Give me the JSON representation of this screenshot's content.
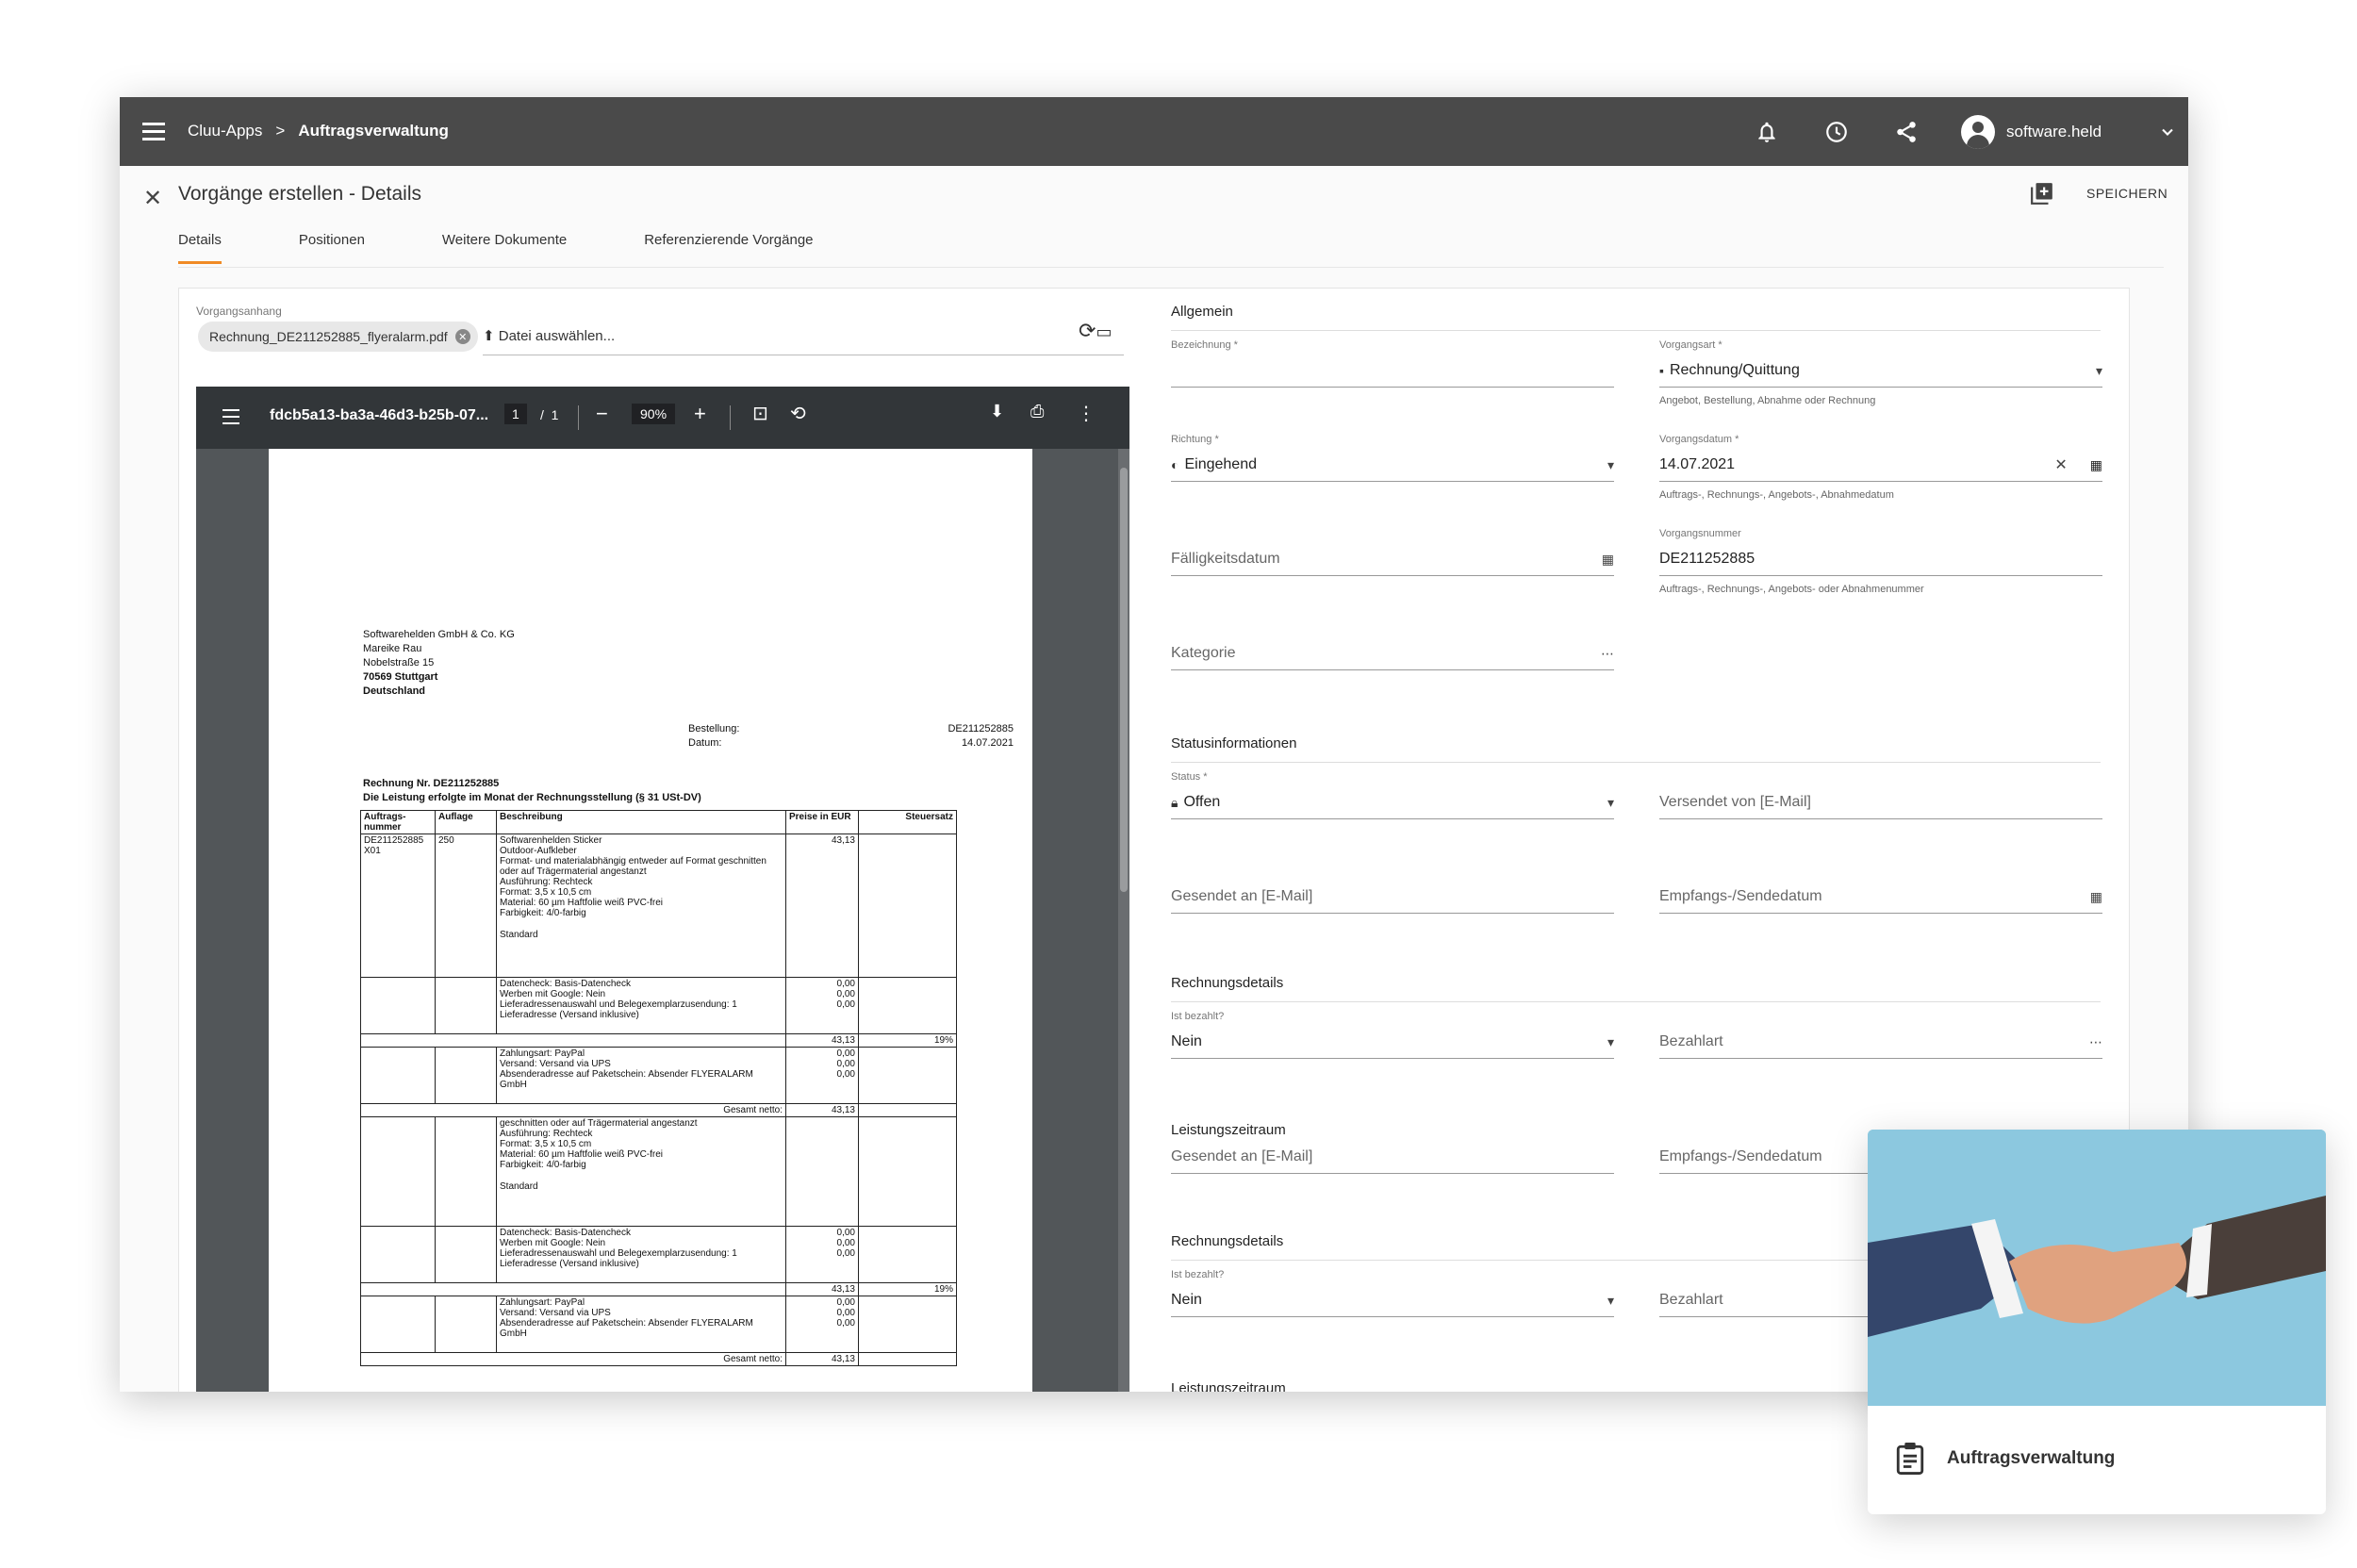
{
  "topbar": {
    "breadcrumb": [
      "Cluu-Apps",
      "Auftragsverwaltung"
    ],
    "separator": ">",
    "username": "software.held",
    "icons": [
      "menu-icon",
      "bell-icon",
      "clock-icon",
      "share-icon",
      "account-icon",
      "chevron-down-icon"
    ]
  },
  "header": {
    "title": "Vorgänge erstellen - Details",
    "save_label": "SPEICHERN",
    "tabs": [
      "Details",
      "Positionen",
      "Weitere Dokumente",
      "Referenzierende Vorgänge"
    ]
  },
  "attachment": {
    "label": "Vorgangsanhang",
    "file_chip": "Rechnung_DE211252885_flyeralarm.pdf",
    "pick_label": "Datei auswählen..."
  },
  "pdf_viewer": {
    "filename": "fdcb5a13-ba3a-46d3-b25b-07...",
    "page_current": "1",
    "page_sep": "/",
    "page_total": "1",
    "zoom": "90%",
    "document": {
      "address": [
        "Softwarehelden GmbH & Co. KG",
        "Mareike Rau",
        "Nobelstraße 15",
        "70569 Stuttgart",
        "Deutschland"
      ],
      "meta_labels": [
        "Bestellung:",
        "Datum:"
      ],
      "meta_values": [
        "DE211252885",
        "14.07.2021"
      ],
      "invoice_title": "Rechnung Nr. DE211252885",
      "invoice_note": "Die Leistung erfolgte im Monat der Rechnungsstellung (§ 31 USt-DV)",
      "columns": [
        "Auftrags-nummer",
        "Auflage",
        "Beschreibung",
        "Preise in EUR",
        "Steuersatz"
      ],
      "order_no": "DE211252885 X01",
      "quantity": "250",
      "item_lines": [
        "Softwarenhelden Sticker",
        "Outdoor-Aufkleber",
        "Format- und materialabhängig entweder auf Format geschnitten oder auf Trägermaterial angestanzt",
        "Ausführung: Rechteck",
        "Format: 3,5 x 10,5 cm",
        "Material: 60 µm Haftfolie weiß PVC-frei",
        "Farbigkeit: 4/0-farbig",
        "",
        "Standard"
      ],
      "item_price": "43,13",
      "check_lines": [
        "Datencheck: Basis-Datencheck",
        "Werben mit Google: Nein",
        "Lieferadressenauswahl und Belegexemplarzusendung: 1 Lieferadresse (Versand inklusive)"
      ],
      "check_prices": [
        "0,00",
        "0,00",
        "0,00"
      ],
      "subtotal": "43,13",
      "tax_rate": "19%",
      "pay_lines": [
        "Zahlungsart: PayPal",
        "Versand: Versand via UPS",
        "Absenderadresse auf Paketschein: Absender FLYERALARM GmbH"
      ],
      "pay_prices": [
        "0,00",
        "0,00",
        "0,00"
      ],
      "net_label": "Gesamt netto:",
      "net_value": "43,13",
      "item_lines_2": [
        "geschnitten oder auf Trägermaterial angestanzt",
        "Ausführung: Rechteck",
        "Format: 3,5 x 10,5 cm",
        "Material: 60 µm Haftfolie weiß PVC-frei",
        "Farbigkeit: 4/0-farbig",
        "",
        "Standard"
      ]
    }
  },
  "form": {
    "allgemein": {
      "title": "Allgemein",
      "bezeichnung_label": "Bezeichnung *",
      "vorgangsart_label": "Vorgangsart *",
      "vorgangsart_value": "Rechnung/Quittung",
      "vorgangsart_hint": "Angebot, Bestellung, Abnahme oder Rechnung",
      "richtung_label": "Richtung *",
      "richtung_value": "Eingehend",
      "vorgangsdatum_label": "Vorgangsdatum *",
      "vorgangsdatum_value": "14.07.2021",
      "vorgangsdatum_hint": "Auftrags-, Rechnungs-, Angebots-, Abnahmedatum",
      "faelligkeit_placeholder": "Fälligkeitsdatum",
      "vorgangsnummer_label": "Vorgangsnummer",
      "vorgangsnummer_value": "DE211252885",
      "vorgangsnummer_hint": "Auftrags-, Rechnungs-, Angebots- oder Abnahmenummer",
      "kategorie_placeholder": "Kategorie"
    },
    "status": {
      "title": "Statusinformationen",
      "status_label": "Status *",
      "status_value": "Offen",
      "versendet_placeholder": "Versendet von [E-Mail]",
      "gesendet_placeholder": "Gesendet an [E-Mail]",
      "empfangs_placeholder": "Empfangs-/Sendedatum"
    },
    "rechnung": {
      "title": "Rechnungsdetails",
      "bezahlt_label": "Ist bezahlt?",
      "bezahlt_value": "Nein",
      "bezahlart_placeholder": "Bezahlart"
    },
    "leistung": {
      "title": "Leistungszeitraum",
      "gesendet_placeholder": "Gesendet an [E-Mail]",
      "empfangs_placeholder": "Empfangs-/Sendedatum"
    },
    "rechnung2": {
      "title": "Rechnungsdetails",
      "bezahlt_label": "Ist bezahlt?",
      "bezahlt_value": "Nein",
      "bezahlart_placeholder": "Bezahlart"
    },
    "leistung2": {
      "title": "Leistungszeitraum"
    }
  },
  "promo_card": {
    "label": "Auftragsverwaltung"
  },
  "colors": {
    "topbar": "#4a4a4a",
    "accent": "#f08a24",
    "viewer_bg": "#525659",
    "viewer_toolbar": "#323639"
  }
}
